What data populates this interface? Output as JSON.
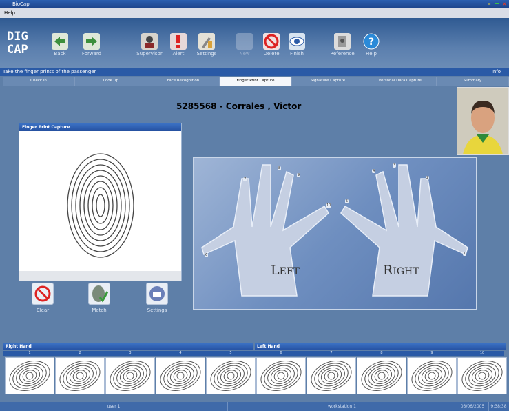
{
  "window": {
    "title": "BioCap"
  },
  "menu": {
    "help": "Help"
  },
  "logo": {
    "line1": "DIG",
    "line2": "CAP"
  },
  "toolbar": {
    "back": "Back",
    "forward": "Forward",
    "supervisor": "Supervisor",
    "alert": "Alert",
    "settings": "Settings",
    "new": "New",
    "delete": "Delete",
    "finish": "Finish",
    "reference": "Reference",
    "help": "Help"
  },
  "infobar": {
    "message": "Take the finger prints of the passenger",
    "info": "Info"
  },
  "tabs": [
    "Check in",
    "Look Up",
    "Face Recognition",
    "Finger Print Capture",
    "Signature Capture",
    "Personal Data Capture",
    "Summary"
  ],
  "passenger": {
    "name": "5285568 - Corrales , Victor"
  },
  "capture_panel": {
    "title": "Finger Print Capture"
  },
  "panel_buttons": {
    "clear": "Clear",
    "match": "Match",
    "settings": "Settings"
  },
  "hands": {
    "left_cap": "L",
    "left_rest": "EFT",
    "right_cap": "R",
    "right_rest": "IGHT",
    "left_fingers": [
      "6",
      "7",
      "8",
      "9",
      "10"
    ],
    "right_fingers": [
      "1",
      "2",
      "3",
      "4",
      "5"
    ]
  },
  "strip": {
    "right_hand": "Right Hand",
    "left_hand": "Left Hand",
    "slots": [
      "1",
      "2",
      "3",
      "4",
      "5",
      "6",
      "7",
      "8",
      "9",
      "10"
    ]
  },
  "status": {
    "user": "user 1",
    "workstation": "workstation 1",
    "date": "03/06/2005",
    "time": "9:38:38"
  },
  "colors": {
    "background": "#5e7fa8",
    "header_blue": "#2a5aa6",
    "active_tab": "#f5f7fa"
  }
}
